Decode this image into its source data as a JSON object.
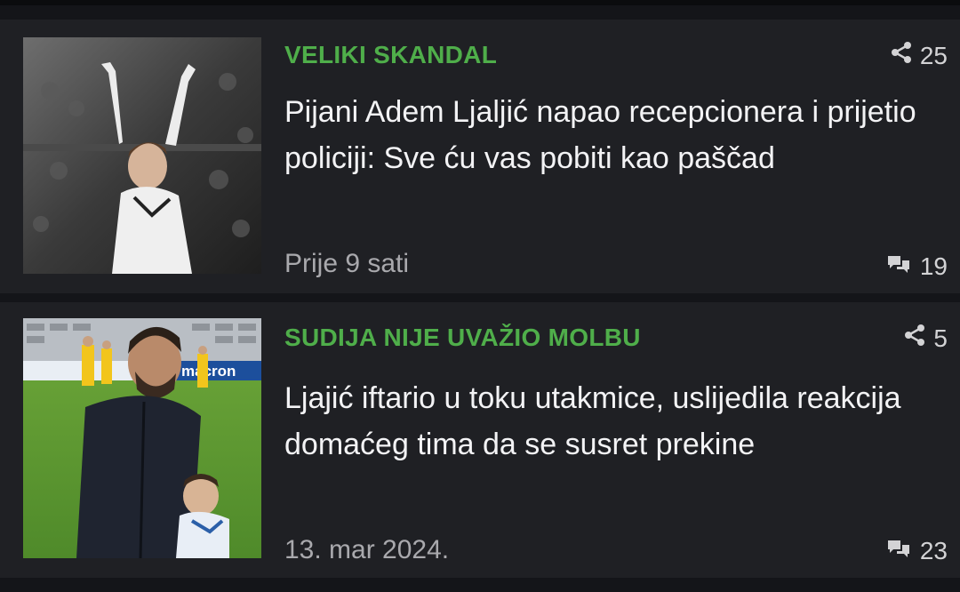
{
  "articles": [
    {
      "category": "VELIKI SKANDAL",
      "shares": "25",
      "headline": "Pijani Adem Ljaljić napao recepcionera i prijetio policiji: Sve ću vas pobiti kao paščad",
      "time": "Prije 9 sati",
      "comments": "19"
    },
    {
      "category": "SUDIJA NIJE UVAŽIO MOLBU",
      "shares": "5",
      "headline": "Ljajić iftario u toku utakmice, uslijedila reakcija domaćeg tima da se susret prekine",
      "time": "13. mar 2024.",
      "comments": "23",
      "thumbnail_banner": "macron"
    }
  ],
  "colors": {
    "background": "#141519",
    "card": "#1f2024",
    "category": "#4fae4a",
    "headline": "#f3f3f5",
    "meta": "#a9a9ad"
  },
  "icons": {
    "share": "share-icon",
    "comments": "comments-icon"
  }
}
